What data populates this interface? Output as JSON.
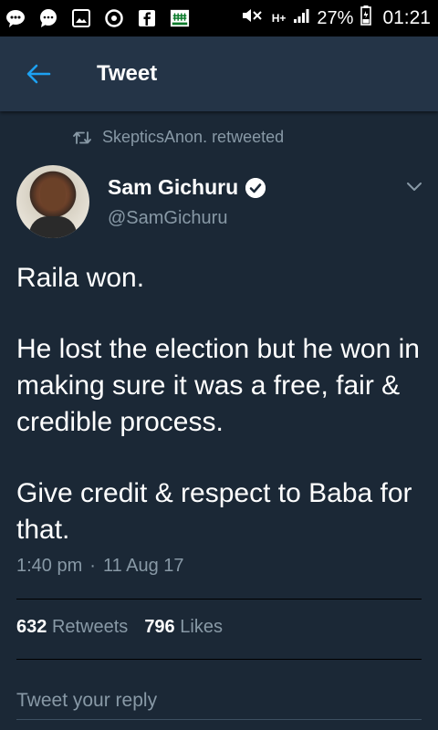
{
  "status_bar": {
    "icons": [
      "messenger-icon",
      "chat-bubble-icon",
      "gallery-icon",
      "chrome-icon",
      "facebook-icon",
      "app-icon"
    ],
    "battery": "27%",
    "time": "01:21",
    "network_label": "H+"
  },
  "app_bar": {
    "title": "Tweet"
  },
  "retweet": {
    "text": "SkepticsAnon. retweeted"
  },
  "author": {
    "name": "Sam Gichuru",
    "handle": "@SamGichuru"
  },
  "tweet": {
    "paragraphs": [
      "Raila won.",
      "He lost the election but he won in making sure it was a free, fair & credible process.",
      "Give credit & respect to Baba for that."
    ],
    "time": "1:40 pm",
    "separator": "·",
    "date": "11 Aug 17"
  },
  "stats": {
    "retweets_count": "632",
    "retweets_label": "Retweets",
    "likes_count": "796",
    "likes_label": "Likes"
  },
  "reply": {
    "placeholder": "Tweet your reply"
  },
  "colors": {
    "background": "#1b2836",
    "app_bar": "#243447",
    "secondary_text": "#8899a6",
    "accent": "#1da1f2"
  }
}
